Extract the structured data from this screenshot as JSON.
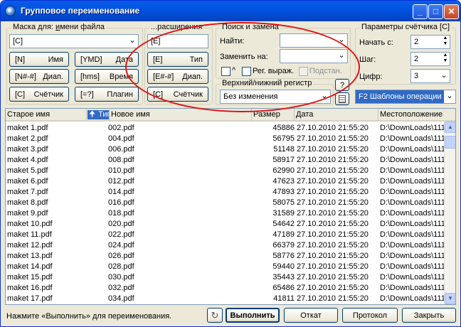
{
  "window": {
    "title": "Групповое переименование"
  },
  "mask": {
    "legend_prefix": "Маска для: ",
    "legend_underlined": "и",
    "legend_rest": "мени файла",
    "value": "[C]",
    "buttons": [
      {
        "code": "[N]",
        "label": "Имя"
      },
      {
        "code": "[YMD]",
        "label": "Дата"
      },
      {
        "code": "[N#-#]",
        "label": "Диап."
      },
      {
        "code": "[hms]",
        "label": "Время"
      },
      {
        "code": "[C]",
        "label": "Счётчик"
      },
      {
        "code": "[=?]",
        "label": "Плагин"
      }
    ]
  },
  "ext": {
    "legend": "...расширения",
    "value": "[E]",
    "buttons": [
      {
        "code": "[E]",
        "label": "Тип"
      },
      {
        "code": "[E#-#]",
        "label": "Диап."
      },
      {
        "code": "[C]",
        "label": "Счётчик"
      }
    ]
  },
  "search": {
    "legend": "Поиск и замена",
    "find_label": "Найти:",
    "find_value": "",
    "replace_label": "Заменить на:",
    "replace_value": "",
    "opt_caret": "^",
    "opt_regex": "Рег. выраж.",
    "opt_subst": "Подстан."
  },
  "case_group": {
    "legend": "Верхний/нижний регистр",
    "value": "Без изменения",
    "help_button": "?"
  },
  "counter": {
    "legend": "Параметры счётчика [C]",
    "start_label": "Начать с:",
    "start_value": "2",
    "step_label": "Шаг:",
    "step_value": "2",
    "digits_label": "Цифр:",
    "digits_value": "3"
  },
  "templates": {
    "label": "F2 Шаблоны операции"
  },
  "table": {
    "columns": {
      "old": "Старое имя",
      "type": "Тип",
      "new": "Новое имя",
      "size": "Размер",
      "date": "Дата",
      "location": "Местоположение"
    },
    "rows": [
      {
        "old": "maket 1.pdf",
        "new": "002.pdf",
        "size": "45886",
        "date": "27.10.2010 21:55:20",
        "location": "D:\\DownLoads\\111"
      },
      {
        "old": "maket 2.pdf",
        "new": "004.pdf",
        "size": "56795",
        "date": "27.10.2010 21:55:20",
        "location": "D:\\DownLoads\\111"
      },
      {
        "old": "maket 3.pdf",
        "new": "006.pdf",
        "size": "51148",
        "date": "27.10.2010 21:55:20",
        "location": "D:\\DownLoads\\111"
      },
      {
        "old": "maket 4.pdf",
        "new": "008.pdf",
        "size": "58917",
        "date": "27.10.2010 21:55:20",
        "location": "D:\\DownLoads\\111"
      },
      {
        "old": "maket 5.pdf",
        "new": "010.pdf",
        "size": "62990",
        "date": "27.10.2010 21:55:20",
        "location": "D:\\DownLoads\\111"
      },
      {
        "old": "maket 6.pdf",
        "new": "012.pdf",
        "size": "47623",
        "date": "27.10.2010 21:55:20",
        "location": "D:\\DownLoads\\111"
      },
      {
        "old": "maket 7.pdf",
        "new": "014.pdf",
        "size": "47893",
        "date": "27.10.2010 21:55:20",
        "location": "D:\\DownLoads\\111"
      },
      {
        "old": "maket 8.pdf",
        "new": "016.pdf",
        "size": "58075",
        "date": "27.10.2010 21:55:20",
        "location": "D:\\DownLoads\\111"
      },
      {
        "old": "maket 9.pdf",
        "new": "018.pdf",
        "size": "31589",
        "date": "27.10.2010 21:55:20",
        "location": "D:\\DownLoads\\111"
      },
      {
        "old": "maket 10.pdf",
        "new": "020.pdf",
        "size": "54642",
        "date": "27.10.2010 21:55:20",
        "location": "D:\\DownLoads\\111"
      },
      {
        "old": "maket 11.pdf",
        "new": "022.pdf",
        "size": "47189",
        "date": "27.10.2010 21:55:20",
        "location": "D:\\DownLoads\\111"
      },
      {
        "old": "maket 12.pdf",
        "new": "024.pdf",
        "size": "66379",
        "date": "27.10.2010 21:55:20",
        "location": "D:\\DownLoads\\111"
      },
      {
        "old": "maket 13.pdf",
        "new": "026.pdf",
        "size": "58776",
        "date": "27.10.2010 21:55:20",
        "location": "D:\\DownLoads\\111"
      },
      {
        "old": "maket 14.pdf",
        "new": "028.pdf",
        "size": "59440",
        "date": "27.10.2010 21:55:20",
        "location": "D:\\DownLoads\\111"
      },
      {
        "old": "maket 15.pdf",
        "new": "030.pdf",
        "size": "35443",
        "date": "27.10.2010 21:55:20",
        "location": "D:\\DownLoads\\111"
      },
      {
        "old": "maket 16.pdf",
        "new": "032.pdf",
        "size": "65486",
        "date": "27.10.2010 21:55:20",
        "location": "D:\\DownLoads\\111"
      },
      {
        "old": "maket 17.pdf",
        "new": "034.pdf",
        "size": "41811",
        "date": "27.10.2010 21:55:20",
        "location": "D:\\DownLoads\\111"
      }
    ]
  },
  "footer": {
    "status": "Нажмите «Выполнить» для переименования.",
    "run": "Выполнить",
    "undo": "Откат",
    "log": "Протокол",
    "close": "Закрыть"
  },
  "colors": {
    "annotation_oval": "#e01010",
    "titlebar": "#0054e3",
    "selection": "#316ac5"
  }
}
